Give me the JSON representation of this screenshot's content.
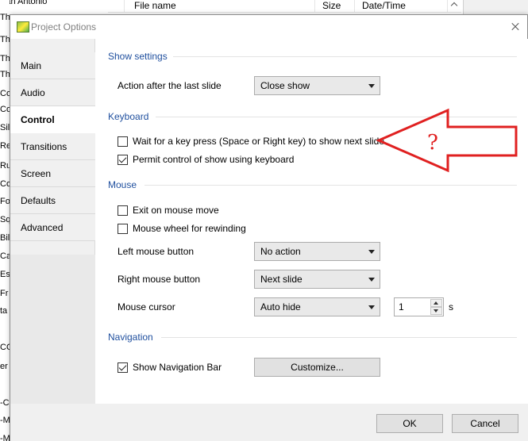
{
  "background": {
    "top_left_text": "San Antonio",
    "left_fragments": [
      "Th",
      "Th",
      "Th",
      "Th",
      "Co",
      "Co",
      "Sil",
      "Re",
      "Ru",
      "Co",
      "Fo",
      "Sq",
      "Bil",
      "Ca",
      "Es",
      "Fr",
      "ta",
      "CO",
      "er",
      "-C",
      "-M",
      "-M"
    ],
    "file_list_header": {
      "col_name": "File name",
      "col_size": "Size",
      "col_date": "Date/Time"
    }
  },
  "dialog": {
    "title": "Project Options",
    "tabs": [
      {
        "label": "Main"
      },
      {
        "label": "Audio"
      },
      {
        "label": "Control"
      },
      {
        "label": "Transitions"
      },
      {
        "label": "Screen"
      },
      {
        "label": "Defaults"
      },
      {
        "label": "Advanced"
      }
    ],
    "active_tab": "Control",
    "show_settings": {
      "title": "Show settings",
      "action_label": "Action after the last slide",
      "action_value": "Close show"
    },
    "keyboard": {
      "title": "Keyboard",
      "wait_key_label": "Wait for a key press (Space or Right key) to show next slide",
      "wait_key_checked": false,
      "permit_control_label": "Permit control of show using keyboard",
      "permit_control_checked": true
    },
    "mouse": {
      "title": "Mouse",
      "exit_on_move_label": "Exit on mouse move",
      "exit_on_move_checked": false,
      "wheel_rewind_label": "Mouse wheel for rewinding",
      "wheel_rewind_checked": false,
      "left_button_label": "Left mouse button",
      "left_button_value": "No action",
      "right_button_label": "Right mouse button",
      "right_button_value": "Next slide",
      "cursor_label": "Mouse cursor",
      "cursor_value": "Auto hide",
      "cursor_seconds": "1",
      "cursor_seconds_unit": "s"
    },
    "navigation": {
      "title": "Navigation",
      "show_nav_bar_label": "Show Navigation Bar",
      "show_nav_bar_checked": true,
      "customize_label": "Customize..."
    },
    "ok_label": "OK",
    "cancel_label": "Cancel"
  },
  "annotation": {
    "symbol": "?",
    "color": "#e02020"
  }
}
